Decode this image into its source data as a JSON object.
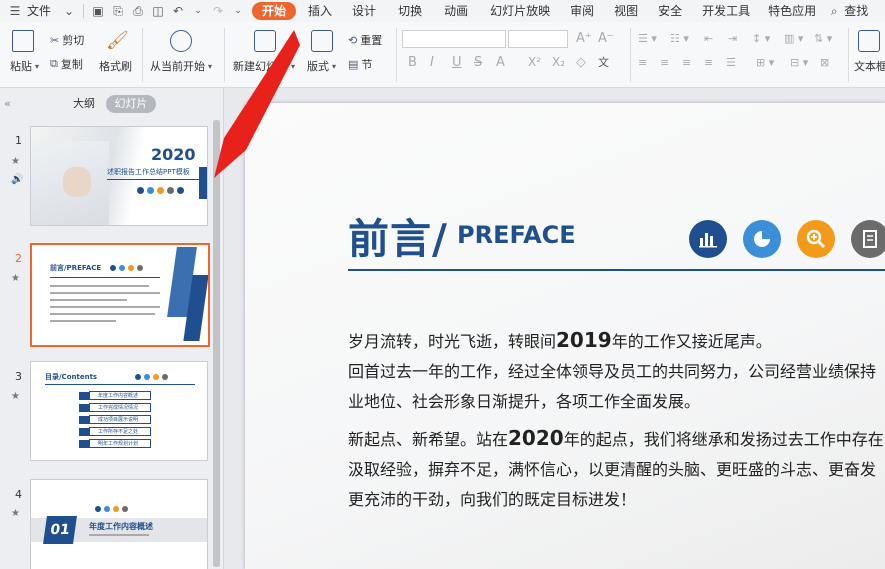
{
  "menubar": {
    "file": "文件",
    "tabs": [
      "开始",
      "插入",
      "设计",
      "切换",
      "动画",
      "幻灯片放映",
      "审阅",
      "视图",
      "安全",
      "开发工具",
      "特色应用"
    ],
    "search": "查找"
  },
  "ribbon": {
    "paste": "粘贴",
    "cut": "剪切",
    "copy": "复制",
    "format_painter": "格式刷",
    "from_current": "从当前开始",
    "new_slide": "新建幻灯片",
    "layout": "版式",
    "reset": "重置",
    "section": "节",
    "text_box": "文本框"
  },
  "leftpanel": {
    "tab_outline": "大纲",
    "tab_slides": "幻灯片",
    "slides": [
      {
        "num": "1",
        "title": "2020",
        "subtitle": "述职报告工作总结PPT模板"
      },
      {
        "num": "2",
        "title": "前言/PREFACE"
      },
      {
        "num": "3",
        "title": "目录/Contents",
        "items": [
          "年度工作内容概述",
          "工作完成情况情况",
          "成功项目展示说明",
          "工作所存不足之处",
          "明年工作规划计划"
        ]
      },
      {
        "num": "4",
        "badge": "01",
        "title": "年度工作内容概述"
      }
    ]
  },
  "slide": {
    "title_cn": "前言/",
    "title_en": "PREFACE",
    "para1_line1_pre": "岁月流转，时光飞逝，转眼间",
    "para1_year": "2019",
    "para1_line1_post": "年的工作又接近尾声。",
    "para2_line1": "回首过去一年的工作，经过全体领导及员工的共同努力，公司经营业绩保持",
    "para2_line2": "业地位、社会形象日渐提升，各项工作全面发展。",
    "para3_line1_pre": "新起点、新希望。站在",
    "para3_year": "2020",
    "para3_line1_post": "年的起点，我们将继承和发扬过去工作中存在",
    "para3_line2": "汲取经验，摒弃不足，满怀信心，以更清醒的头脑、更旺盛的斗志、更奋发",
    "para3_line3": "更充沛的干劲，向我们的既定目标进发！",
    "icon_colors": [
      "#1f4f8f",
      "#3a8fd8",
      "#f39a1a",
      "#6b6b6b"
    ]
  },
  "colors": {
    "accent": "#f0642d",
    "brand_blue": "#1f4f8f",
    "arrow": "#e8211b"
  }
}
